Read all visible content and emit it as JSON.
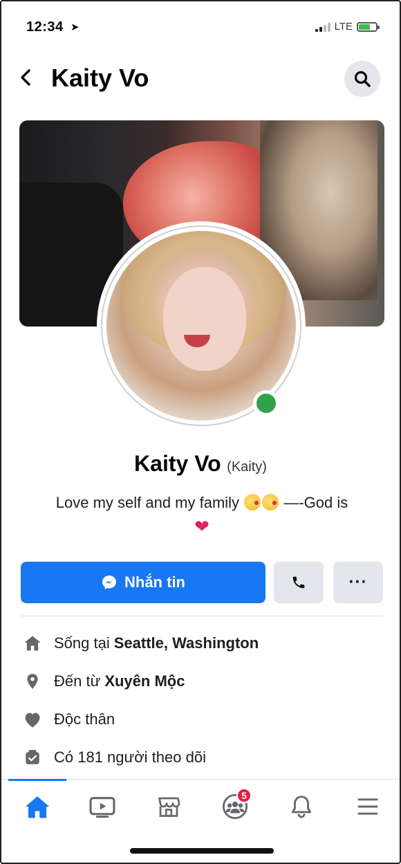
{
  "status_bar": {
    "time": "12:34",
    "location_glyph": "➤",
    "network": "LTE"
  },
  "header": {
    "title": "Kaity Vo"
  },
  "profile": {
    "name": "Kaity Vo",
    "alternate_name": "(Kaity)",
    "bio": "Love my self and my family",
    "bio_after_emoji": "—-God is",
    "online": true
  },
  "actions": {
    "message_label": "Nhắn tin"
  },
  "info": {
    "lives_in_prefix": "Sống tại",
    "lives_in_value": "Seattle, Washington",
    "from_prefix": "Đến từ",
    "from_value": "Xuyên Mộc",
    "relationship": "Độc thân",
    "followers": "Có 181 người theo dõi"
  },
  "bottom_nav": {
    "groups_badge": "5",
    "items": [
      "home-icon",
      "watch-icon",
      "marketplace-icon",
      "groups-icon",
      "notifications-icon",
      "menu-icon"
    ]
  },
  "colors": {
    "accent": "#1877f2",
    "online": "#31a24c",
    "badge": "#e41e3f"
  }
}
